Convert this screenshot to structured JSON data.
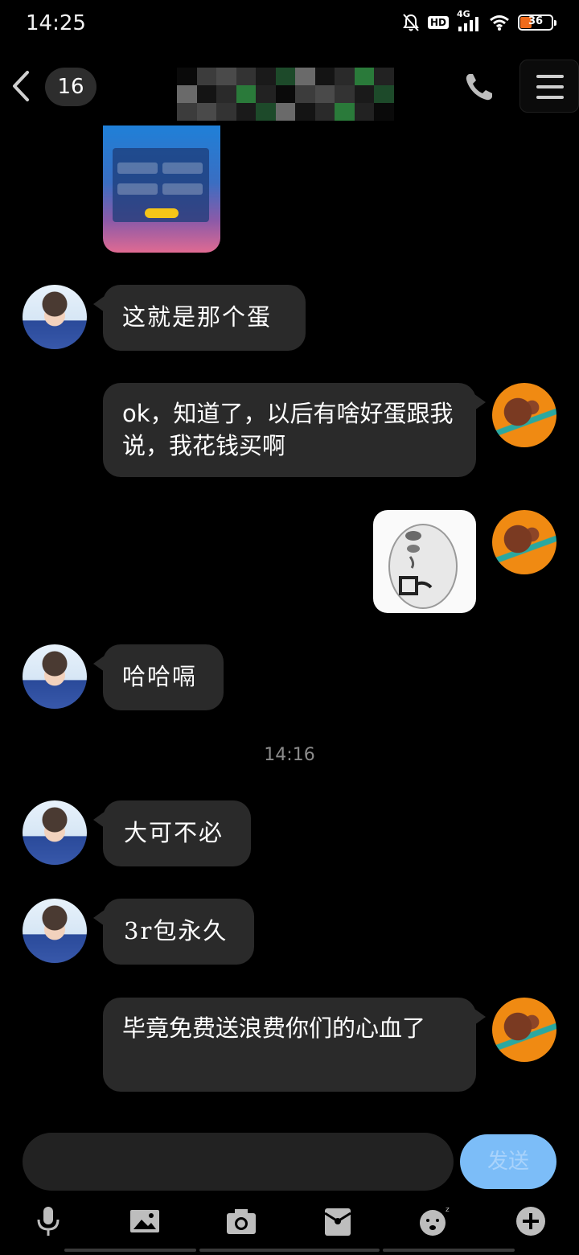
{
  "status_bar": {
    "time": "14:25",
    "network": "4G",
    "hd_badge": "HD",
    "battery_level": "36",
    "battery_fraction": 0.36
  },
  "header": {
    "unread_count": "16",
    "icons": {
      "back": "chevron-left-icon",
      "call": "phone-icon",
      "menu": "hamburger-menu-icon"
    }
  },
  "messages": [
    {
      "side": "left",
      "type": "image"
    },
    {
      "side": "left",
      "type": "text",
      "text": "这就是那个蛋"
    },
    {
      "side": "right",
      "type": "text",
      "text": "ok，知道了，以后有啥好蛋跟我说，我花钱买啊"
    },
    {
      "side": "right",
      "type": "sticker"
    },
    {
      "side": "left",
      "type": "text",
      "text": "哈哈嗝"
    },
    {
      "side": "left",
      "type": "text",
      "text": "大可不必"
    },
    {
      "side": "left",
      "type": "text",
      "text": "3r包永久"
    },
    {
      "side": "right",
      "type": "text",
      "text": "毕竟免费送浪费你们的心血了"
    }
  ],
  "time_divider": "14:16",
  "composer": {
    "input_value": "",
    "send_label": "发送"
  },
  "toolbar": [
    "microphone-icon",
    "image-icon",
    "camera-icon",
    "red-packet-icon",
    "sticker-icon",
    "plus-icon"
  ],
  "colors": {
    "background": "#000000",
    "bubble": "#2a2a2a",
    "send_button": "#7cbdf8",
    "battery": "#f06b1c"
  }
}
